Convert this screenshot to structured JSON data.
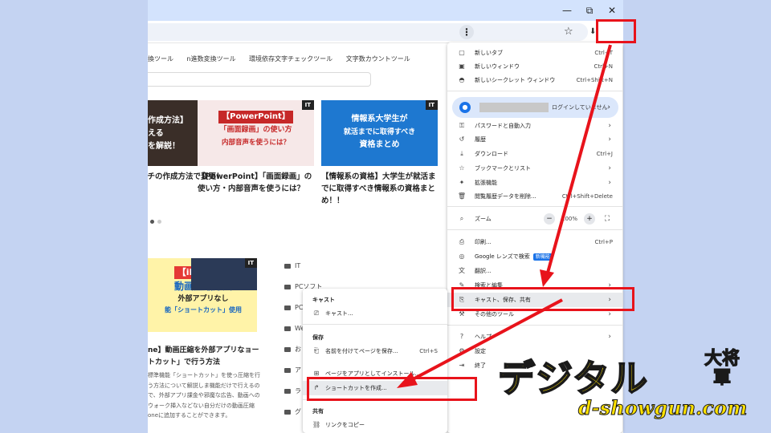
{
  "browser": {
    "window_controls": {
      "minimize": "—",
      "maximize": "⧉",
      "close": "✕"
    },
    "star_icon": "star-icon",
    "menu_icon": "⋮"
  },
  "site": {
    "nav_links": [
      "換ツール",
      "n進数変換ツール",
      "環境依存文字チェックツール",
      "文字数カウントツール"
    ],
    "cards": [
      {
        "badge": "IT",
        "thumb_lines": [
          "作成方法】",
          "える",
          "を解説！"
        ],
        "title": "ッチの作成方法で変更！"
      },
      {
        "badge": "IT",
        "thumb_lines": [
          "【PowerPoint】",
          "「画面録画」の使い方",
          "内部音声を使うには？"
        ],
        "title": "【PowerPoint】「画面録画」の使い方・内部音声を使うには？"
      },
      {
        "badge": "IT",
        "thumb_lines": [
          "情報系大学生が",
          "就活までに取得すべき",
          "資格まとめ"
        ],
        "title": "【情報系の資格】大学生が就活までに取得すべき情報系の資格まとめ！！"
      }
    ],
    "feature": {
      "badge": "IT",
      "thumb_lines": [
        "【iPhone】",
        "動画圧縮方法",
        "外部アプリなし",
        "能「ショートカット」使用"
      ],
      "title": "ne】動画圧縮を外部アプリなョートカット」で行う方法",
      "body": "標準機能「ショートカット」を使っ圧縮を行う方法について解説しま機能だけで行えるので、外部アプリ課金や邪魔な広告、動画へのウォーク挿入などない自分だけの動画圧縮oneに追加することができます。"
    },
    "categories": [
      "IT",
      "PCソフト",
      "PC",
      "We",
      "お",
      "ア",
      "ラ",
      "グ"
    ]
  },
  "chrome_menu": {
    "items": [
      {
        "icon": "new-tab-icon",
        "label": "新しいタブ",
        "shortcut": "Ctrl+T"
      },
      {
        "icon": "new-window-icon",
        "label": "新しいウィンドウ",
        "shortcut": "Ctrl+N"
      },
      {
        "icon": "incognito-icon",
        "label": "新しいシークレット ウィンドウ",
        "shortcut": "Ctrl+Shift+N"
      }
    ],
    "profile_label": "ログインしていません",
    "items2": [
      {
        "icon": "key-icon",
        "label": "パスワードと自動入力",
        "arrow": "›"
      },
      {
        "icon": "history-icon",
        "label": "履歴",
        "arrow": "›"
      },
      {
        "icon": "download-icon",
        "label": "ダウンロード",
        "shortcut": "Ctrl+J"
      },
      {
        "icon": "bookmark-icon",
        "label": "ブックマークとリスト",
        "arrow": "›"
      },
      {
        "icon": "extension-icon",
        "label": "拡張機能",
        "arrow": "›"
      },
      {
        "icon": "trash-icon",
        "label": "閲覧履歴データを削除...",
        "shortcut": "Ctrl+Shift+Delete"
      }
    ],
    "zoom_label": "ズーム",
    "zoom_value": "100%",
    "items3": [
      {
        "icon": "print-icon",
        "label": "印刷...",
        "shortcut": "Ctrl+P"
      },
      {
        "icon": "lens-icon",
        "label": "Google レンズで検索",
        "badge": "新機能"
      },
      {
        "icon": "translate-icon",
        "label": "翻訳..."
      },
      {
        "icon": "find-icon",
        "label": "検索と編集",
        "arrow": "›"
      },
      {
        "icon": "cast-save-icon",
        "label": "キャスト、保存、共有",
        "arrow": "›"
      },
      {
        "icon": "tools-icon",
        "label": "その他のツール",
        "arrow": "›"
      }
    ],
    "items4": [
      {
        "icon": "help-icon",
        "label": "ヘルプ",
        "arrow": "›"
      },
      {
        "icon": "settings-icon",
        "label": "設定"
      },
      {
        "icon": "exit-icon",
        "label": "終了"
      }
    ]
  },
  "submenu": {
    "cast_header": "キャスト",
    "cast_item": "キャスト...",
    "save_header": "保存",
    "save_item": "名前を付けてページを保存...",
    "save_shortcut": "Ctrl+S",
    "install_item": "ページをアプリとしてインストール...",
    "shortcut_item": "ショートカットを作成...",
    "share_header": "共有",
    "copy_link_item": "リンクをコピー"
  },
  "branding": {
    "main": "デジタル",
    "side": "大将軍",
    "url": "d-showgun.com"
  },
  "colors": {
    "highlight_red": "#e8131b",
    "brand_yellow": "#ffe100",
    "accent_blue": "#1a73e8"
  }
}
